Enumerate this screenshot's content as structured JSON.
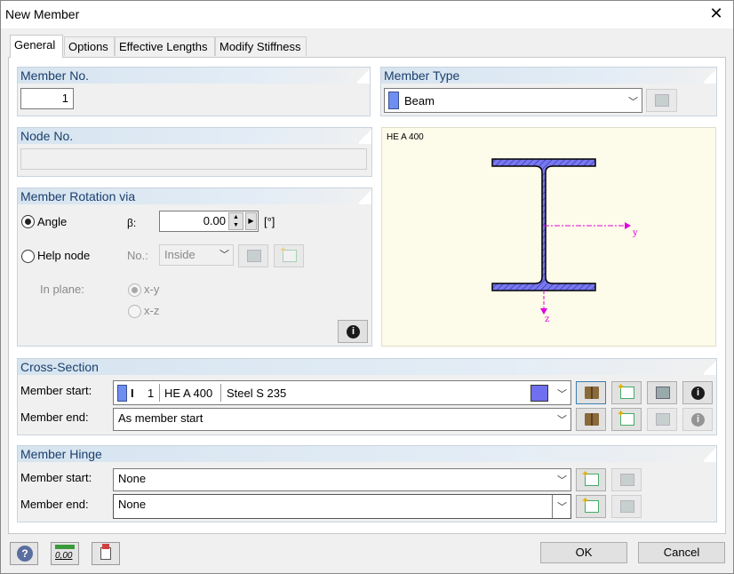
{
  "window": {
    "title": "New Member",
    "close_glyph": "✕"
  },
  "tabs": [
    {
      "label": "General",
      "active": true
    },
    {
      "label": "Options"
    },
    {
      "label": "Effective Lengths"
    },
    {
      "label": "Modify Stiffness"
    }
  ],
  "member_no": {
    "title": "Member No.",
    "value": "1"
  },
  "node_no": {
    "title": "Node No.",
    "value": ""
  },
  "member_type": {
    "title": "Member Type",
    "value": "Beam",
    "swatch_color": "#6f8ef2"
  },
  "rotation": {
    "title": "Member Rotation via",
    "angle_label": "Angle",
    "beta_label": "β:",
    "angle_value": "0.00",
    "unit": "[°]",
    "help_node_label": "Help node",
    "no_label": "No.:",
    "no_value": "Inside",
    "in_plane_label": "In plane:",
    "plane_xy": "x-y",
    "plane_xz": "x-z"
  },
  "preview": {
    "section_name": "HE A 400",
    "axis_y": "y",
    "axis_z": "z",
    "accent": "#e000e0",
    "flange_color": "#6f6ff0"
  },
  "cross_section": {
    "title": "Cross-Section",
    "start_label": "Member start:",
    "end_label": "Member end:",
    "start_number": "1",
    "start_section": "HE A 400",
    "start_material": "Steel S 235",
    "end_value": "As member start",
    "start_color": "#6f6ff0"
  },
  "hinge": {
    "title": "Member Hinge",
    "start_label": "Member start:",
    "end_label": "Member end:",
    "start_value": "None",
    "end_value": "None"
  },
  "footer": {
    "ok": "OK",
    "cancel": "Cancel",
    "units_label": "0,00"
  }
}
